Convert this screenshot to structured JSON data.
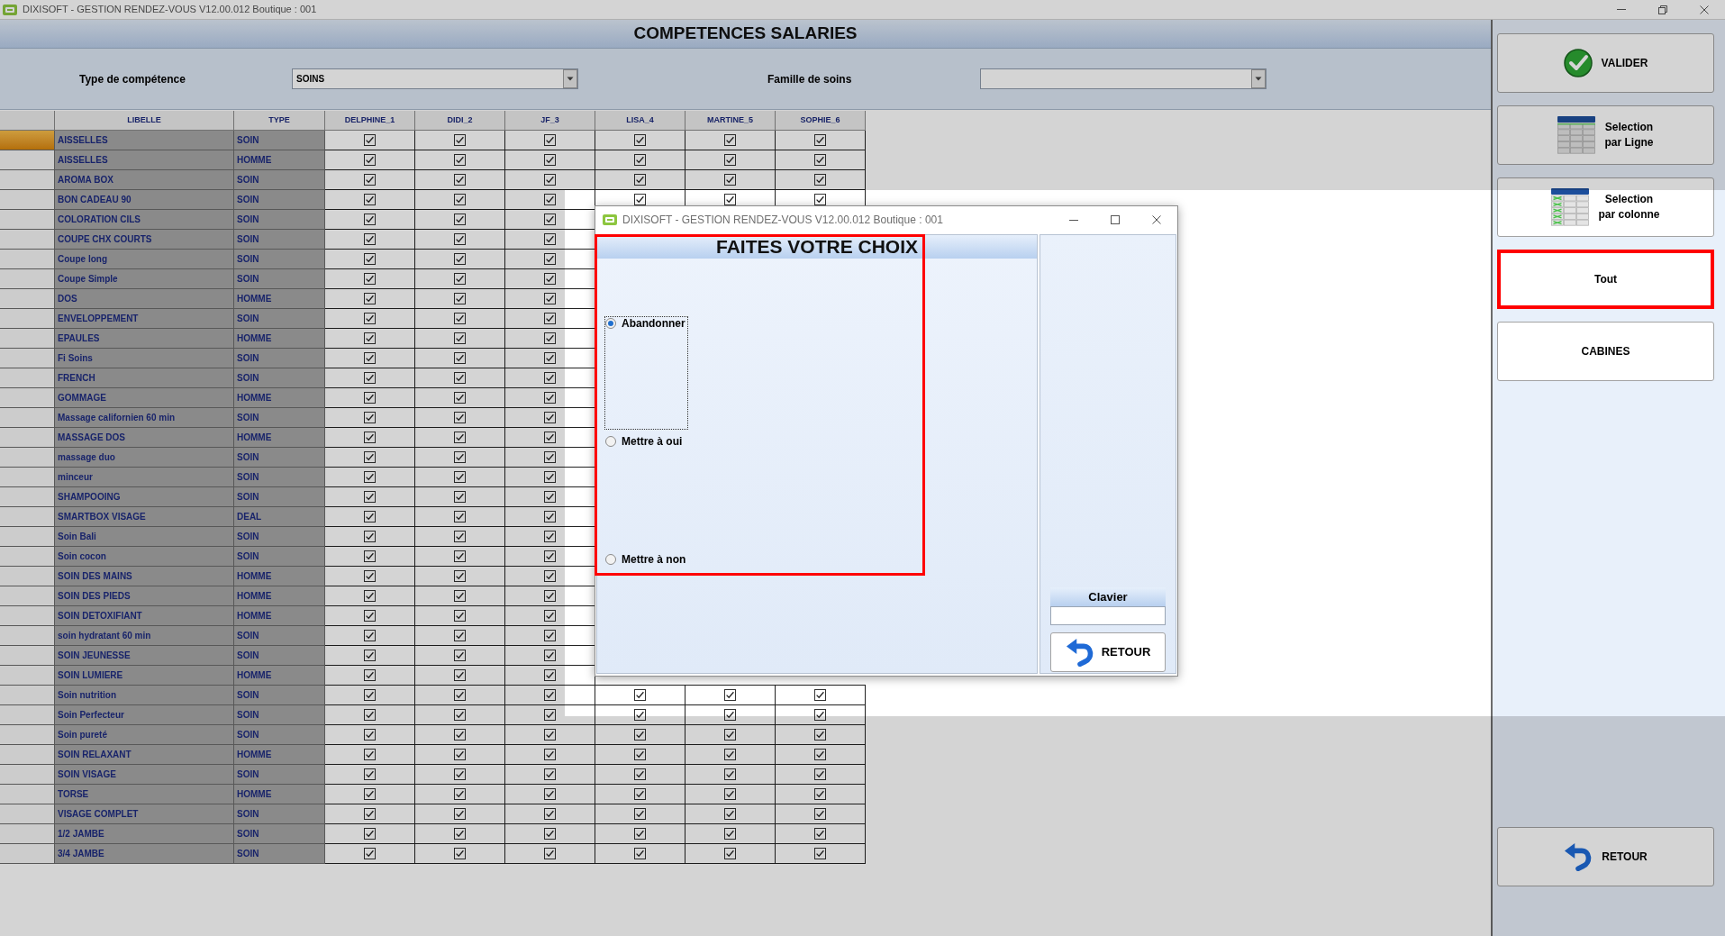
{
  "window": {
    "title": "DIXISOFT - GESTION RENDEZ-VOUS V12.00.012 Boutique : 001"
  },
  "page_title": "COMPETENCES SALARIES",
  "filters": [
    {
      "label": "Type de compétence",
      "value": "SOINS"
    },
    {
      "label": "Famille de soins"
    }
  ],
  "table": {
    "columns": [
      "LIBELLE",
      "TYPE",
      "DELPHINE_1",
      "DIDI_2",
      "JF_3",
      "LISA_4",
      "MARTINE_5",
      "SOPHIE_6"
    ],
    "rows": [
      {
        "label": "AISSELLES",
        "type": "SOIN",
        "selected": true,
        "checks": [
          true,
          true,
          true,
          true,
          true,
          true
        ]
      },
      {
        "label": "AISSELLES",
        "type": "HOMME",
        "selected": false,
        "checks": [
          true,
          true,
          true,
          true,
          true,
          true
        ]
      },
      {
        "label": "AROMA BOX",
        "type": "SOIN",
        "selected": false,
        "checks": [
          true,
          true,
          true,
          true,
          true,
          true
        ]
      },
      {
        "label": "BON CADEAU 90",
        "type": "SOIN",
        "selected": false,
        "checks": [
          true,
          true,
          true,
          true,
          true,
          true
        ]
      },
      {
        "label": "COLORATION CILS",
        "type": "SOIN",
        "selected": false,
        "checks": [
          true,
          true,
          true
        ]
      },
      {
        "label": "COUPE CHX COURTS",
        "type": "SOIN",
        "selected": false,
        "checks": [
          true,
          true,
          true
        ]
      },
      {
        "label": "Coupe long",
        "type": "SOIN",
        "selected": false,
        "checks": [
          true,
          true,
          true
        ]
      },
      {
        "label": "Coupe Simple",
        "type": "SOIN",
        "selected": false,
        "checks": [
          true,
          true,
          true
        ]
      },
      {
        "label": "DOS",
        "type": "HOMME",
        "selected": false,
        "checks": [
          true,
          true,
          true
        ]
      },
      {
        "label": "ENVELOPPEMENT",
        "type": "SOIN",
        "selected": false,
        "checks": [
          true,
          true,
          true
        ]
      },
      {
        "label": "EPAULES",
        "type": "HOMME",
        "selected": false,
        "checks": [
          true,
          true,
          true
        ]
      },
      {
        "label": "Fi Soins",
        "type": "SOIN",
        "selected": false,
        "checks": [
          true,
          true,
          true
        ]
      },
      {
        "label": "FRENCH",
        "type": "SOIN",
        "selected": false,
        "checks": [
          true,
          true,
          true
        ]
      },
      {
        "label": "GOMMAGE",
        "type": "HOMME",
        "selected": false,
        "checks": [
          true,
          true,
          true
        ]
      },
      {
        "label": "Massage californien 60 min",
        "type": "SOIN",
        "selected": false,
        "checks": [
          true,
          true,
          true
        ]
      },
      {
        "label": "MASSAGE DOS",
        "type": "HOMME",
        "selected": false,
        "checks": [
          true,
          true,
          true
        ]
      },
      {
        "label": "massage duo",
        "type": "SOIN",
        "selected": false,
        "checks": [
          true,
          true,
          true
        ]
      },
      {
        "label": "minceur",
        "type": "SOIN",
        "selected": false,
        "checks": [
          true,
          true,
          true
        ]
      },
      {
        "label": "SHAMPOOING",
        "type": "SOIN",
        "selected": false,
        "checks": [
          true,
          true,
          true
        ]
      },
      {
        "label": "SMARTBOX VISAGE",
        "type": "DEAL",
        "selected": false,
        "checks": [
          true,
          true,
          true
        ]
      },
      {
        "label": "Soin Bali",
        "type": "SOIN",
        "selected": false,
        "checks": [
          true,
          true,
          true
        ]
      },
      {
        "label": "Soin cocon",
        "type": "SOIN",
        "selected": false,
        "checks": [
          true,
          true,
          true
        ]
      },
      {
        "label": "SOIN DES MAINS",
        "type": "HOMME",
        "selected": false,
        "checks": [
          true,
          true,
          true
        ]
      },
      {
        "label": "SOIN DES PIEDS",
        "type": "HOMME",
        "selected": false,
        "checks": [
          true,
          true,
          true
        ]
      },
      {
        "label": "SOIN DETOXIFIANT",
        "type": "HOMME",
        "selected": false,
        "checks": [
          true,
          true,
          true
        ]
      },
      {
        "label": "soin hydratant 60 min",
        "type": "SOIN",
        "selected": false,
        "checks": [
          true,
          true,
          true
        ]
      },
      {
        "label": "SOIN JEUNESSE",
        "type": "SOIN",
        "selected": false,
        "checks": [
          true,
          true,
          true
        ]
      },
      {
        "label": "SOIN LUMIERE",
        "type": "HOMME",
        "selected": false,
        "checks": [
          true,
          true,
          true
        ]
      },
      {
        "label": "Soin nutrition",
        "type": "SOIN",
        "selected": false,
        "checks": [
          true,
          true,
          true,
          true,
          true,
          true
        ]
      },
      {
        "label": "Soin Perfecteur",
        "type": "SOIN",
        "selected": false,
        "checks": [
          true,
          true,
          true,
          true,
          true,
          true
        ]
      },
      {
        "label": "Soin pureté",
        "type": "SOIN",
        "selected": false,
        "checks": [
          true,
          true,
          true,
          true,
          true,
          true
        ]
      },
      {
        "label": "SOIN RELAXANT",
        "type": "HOMME",
        "selected": false,
        "checks": [
          true,
          true,
          true,
          true,
          true,
          true
        ]
      },
      {
        "label": "SOIN VISAGE",
        "type": "SOIN",
        "selected": false,
        "checks": [
          true,
          true,
          true,
          true,
          true,
          true
        ]
      },
      {
        "label": "TORSE",
        "type": "HOMME",
        "selected": false,
        "checks": [
          true,
          true,
          true,
          true,
          true,
          true
        ]
      },
      {
        "label": "VISAGE COMPLET",
        "type": "SOIN",
        "selected": false,
        "checks": [
          true,
          true,
          true,
          true,
          true,
          true
        ]
      },
      {
        "label": "1/2 JAMBE",
        "type": "SOIN",
        "selected": false,
        "checks": [
          true,
          true,
          true,
          true,
          true,
          true
        ]
      },
      {
        "label": "3/4 JAMBE",
        "type": "SOIN",
        "selected": false,
        "checks": [
          true,
          true,
          true,
          true,
          true,
          true
        ]
      }
    ]
  },
  "side_buttons": [
    {
      "kind": "validate",
      "label": "VALIDER",
      "highlighted": false
    },
    {
      "kind": "row-select",
      "label": "Selection\npar Ligne",
      "highlighted": false
    },
    {
      "kind": "column-select",
      "label": "Selection\npar colonne",
      "highlighted": false
    },
    {
      "kind": "plain",
      "label": "Tout",
      "highlighted": true
    },
    {
      "kind": "plain",
      "label": "CABINES",
      "highlighted": false
    }
  ],
  "back_button": {
    "kind": "back",
    "label": "RETOUR",
    "highlighted": false
  },
  "dialog": {
    "title": "DIXISOFT - GESTION RENDEZ-VOUS V12.00.012 Boutique : 001",
    "heading": "FAITES VOTRE CHOIX",
    "highlighted": true,
    "options": [
      {
        "label": "Abandonner",
        "selected": true
      },
      {
        "label": "Mettre à oui",
        "selected": false
      },
      {
        "label": "Mettre à non",
        "selected": false
      }
    ],
    "keyboard": {
      "label": "Clavier"
    },
    "back_button": {
      "label": "RETOUR"
    }
  }
}
